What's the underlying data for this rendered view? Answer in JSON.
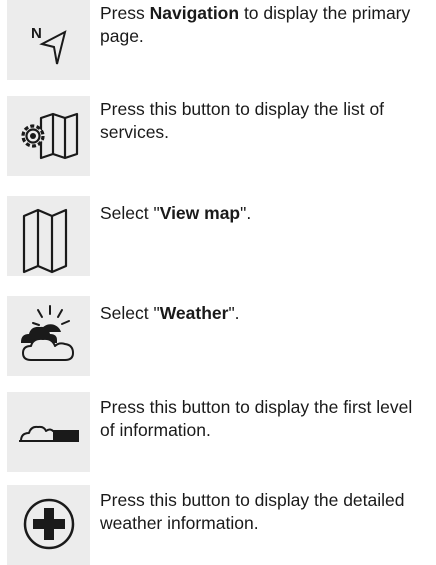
{
  "steps": [
    {
      "icon": "navigation-icon",
      "parts": [
        "Press ",
        "Navigation",
        " to display the primary page."
      ]
    },
    {
      "icon": "services-map-icon",
      "parts": [
        "Press this button to display the list of services."
      ]
    },
    {
      "icon": "map-icon",
      "parts": [
        "Select \"",
        "View map",
        "\"."
      ]
    },
    {
      "icon": "weather-icon",
      "parts": [
        "Select \"",
        "Weather",
        "\"."
      ]
    },
    {
      "icon": "weather-level-icon",
      "parts": [
        "Press this button to display the first level of information."
      ]
    },
    {
      "icon": "plus-circle-icon",
      "parts": [
        "Press this button to display the detailed weather information."
      ]
    }
  ],
  "icons": {
    "nav_letter": "N"
  }
}
